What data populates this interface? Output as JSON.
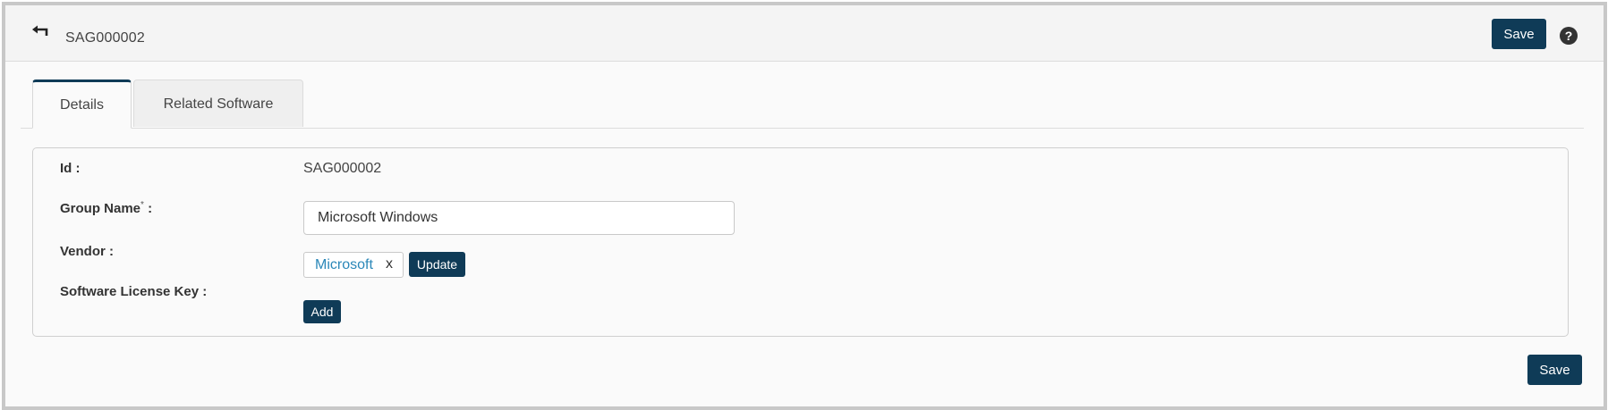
{
  "header": {
    "back_icon": "back-arrow-icon",
    "record_id": "SAG000002",
    "save_label": "Save",
    "help_icon": "question-circle-icon",
    "help_glyph": "?"
  },
  "tabs": [
    {
      "label": "Details",
      "active": true
    },
    {
      "label": "Related Software",
      "active": false
    }
  ],
  "form": {
    "id": {
      "label": "Id :",
      "value": "SAG000002"
    },
    "group_name": {
      "label": "Group Name",
      "required_mark": "*",
      "suffix": " :",
      "value": "Microsoft Windows"
    },
    "vendor": {
      "label": "Vendor :",
      "value": "Microsoft",
      "remove_label": "x",
      "update_label": "Update"
    },
    "license_key": {
      "label": "Software License Key :",
      "add_label": "Add"
    }
  },
  "footer": {
    "save_label": "Save"
  },
  "colors": {
    "primary_button": "#0f3b57",
    "link": "#2a87b8",
    "frame_border": "#c8c8c8"
  }
}
